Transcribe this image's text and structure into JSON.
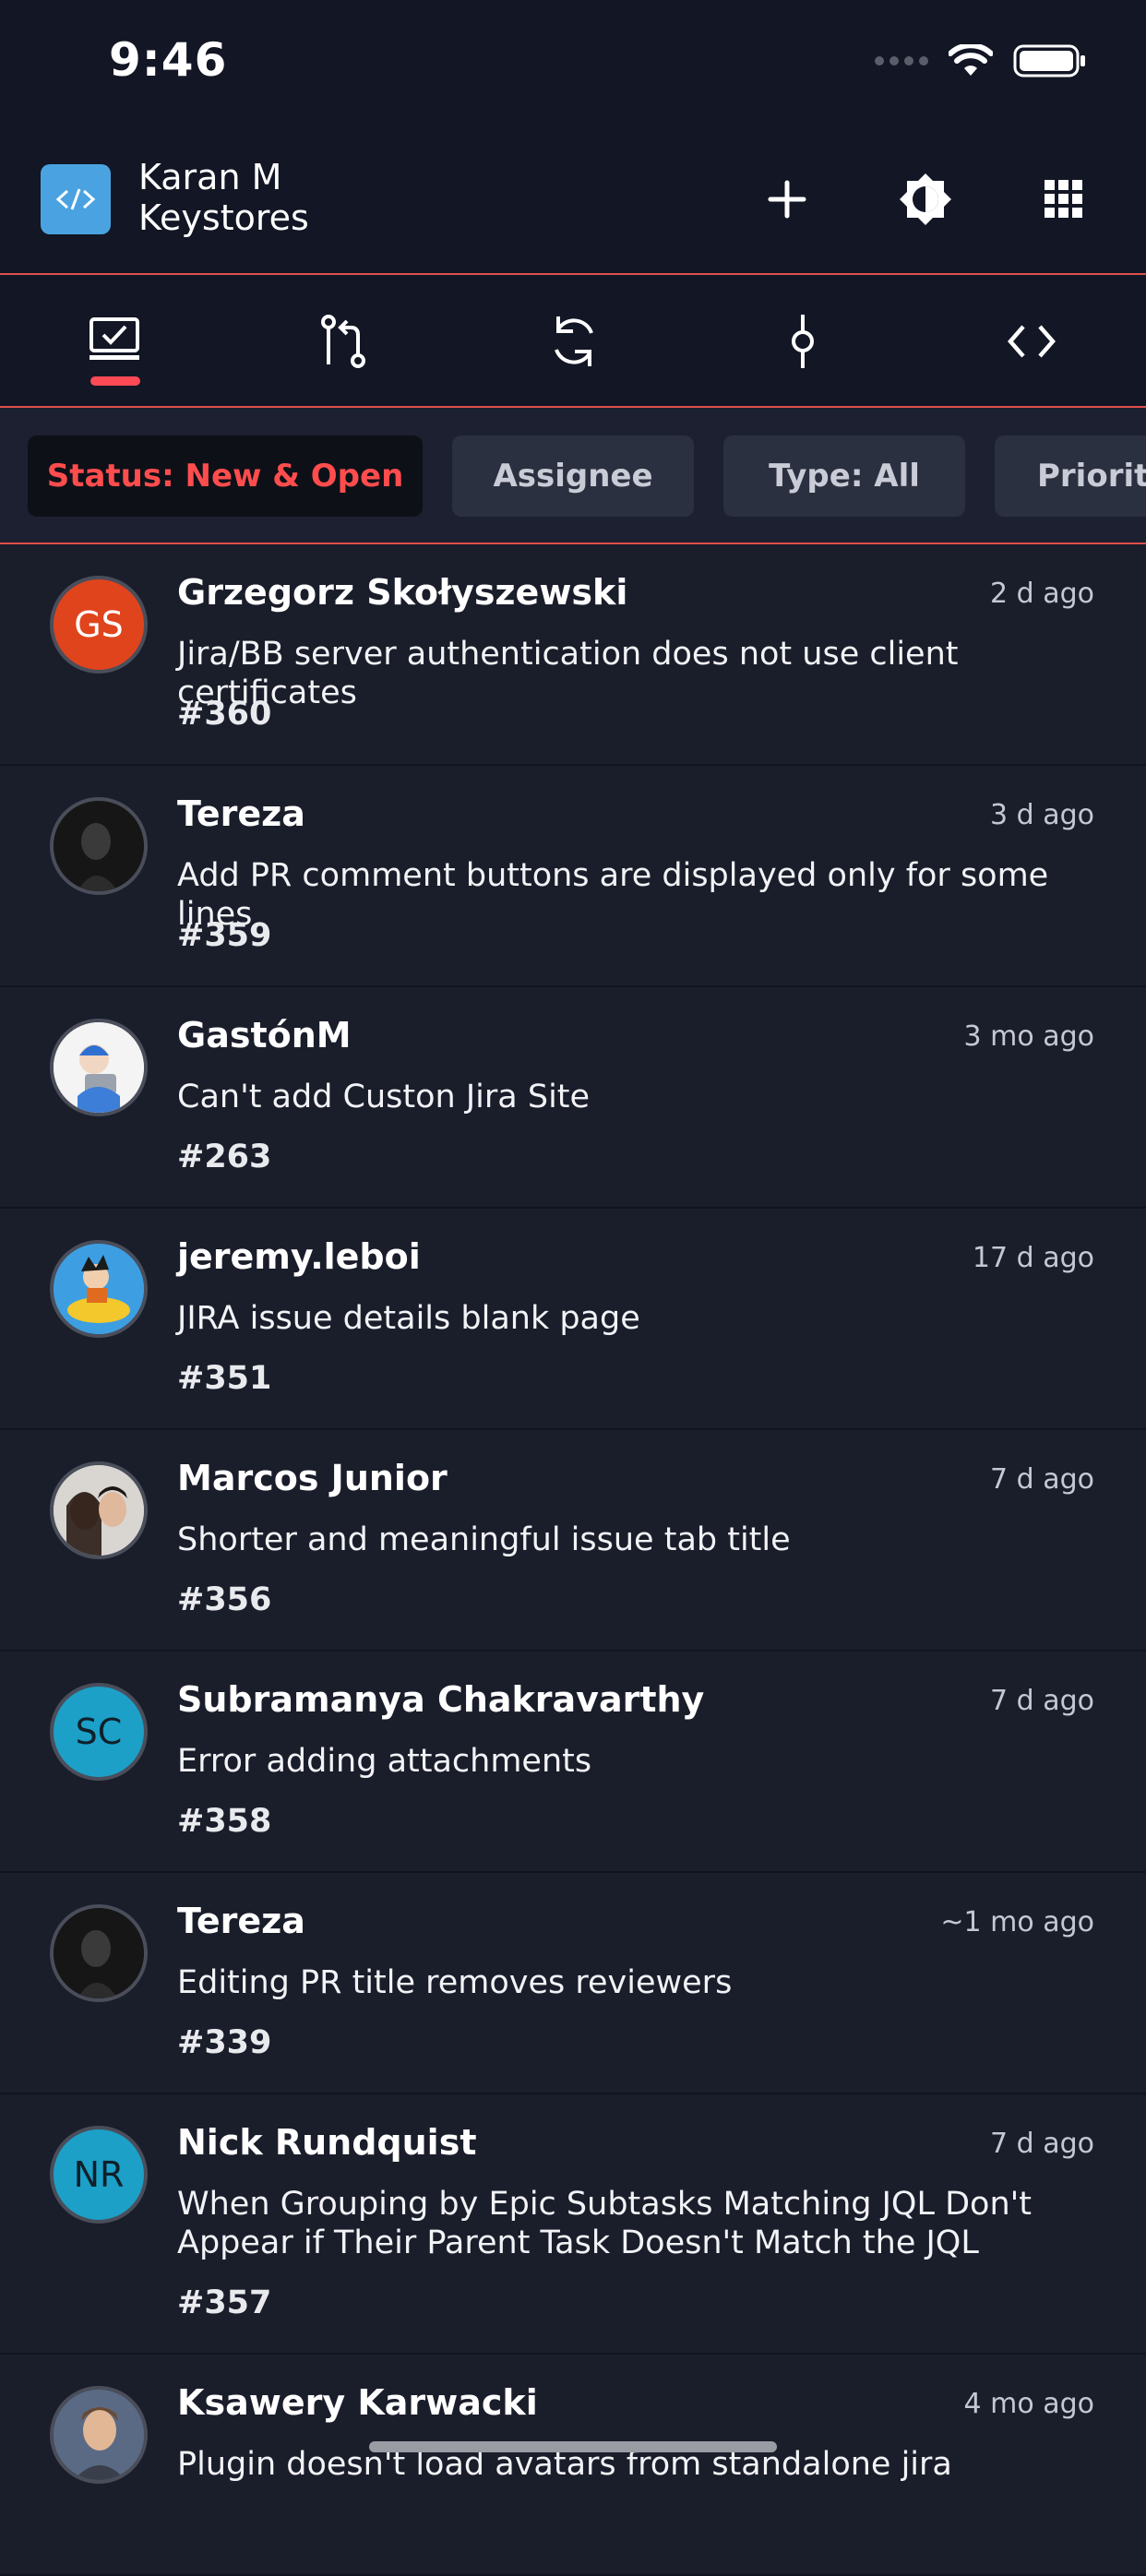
{
  "status_bar": {
    "time": "9:46"
  },
  "header": {
    "title": "Karan M",
    "subtitle": "Keystores"
  },
  "filters": [
    {
      "label": "Status: New & Open",
      "active": true
    },
    {
      "label": "Assignee",
      "active": false
    },
    {
      "label": "Type: All",
      "active": false
    },
    {
      "label": "Priority",
      "active": false
    }
  ],
  "issues": [
    {
      "author": "Grzegorz Skołyszewski",
      "initials": "GS",
      "time": "2 d ago",
      "title": "Jira/BB server authentication does not use client certificates",
      "number": "#360"
    },
    {
      "author": "Tereza",
      "initials": "",
      "time": "3 d ago",
      "title": "Add PR comment buttons are displayed only for some lines",
      "number": "#359"
    },
    {
      "author": "GastónM",
      "initials": "",
      "time": "3 mo ago",
      "title": "Can't add Custon Jira Site",
      "number": "#263"
    },
    {
      "author": "jeremy.leboi",
      "initials": "",
      "time": "17 d ago",
      "title": "JIRA issue details blank page",
      "number": "#351"
    },
    {
      "author": "Marcos Junior",
      "initials": "",
      "time": "7 d ago",
      "title": "Shorter and meaningful issue tab title",
      "number": "#356"
    },
    {
      "author": "Subramanya Chakravarthy",
      "initials": "SC",
      "time": "7 d ago",
      "title": "Error adding attachments",
      "number": "#358"
    },
    {
      "author": "Tereza",
      "initials": "",
      "time": "~1 mo ago",
      "title": "Editing PR title removes reviewers",
      "number": "#339"
    },
    {
      "author": "Nick Rundquist",
      "initials": "NR",
      "time": "7 d ago",
      "title": "When Grouping by Epic Subtasks Matching JQL Don't Appear if Their Parent Task Doesn't Match the JQL",
      "number": "#357"
    },
    {
      "author": "Ksawery Karwacki",
      "initials": "",
      "time": "4 mo ago",
      "title": "Plugin doesn't load avatars from standalone jira",
      "number": ""
    }
  ],
  "colors": {
    "accent": "#ff4a55",
    "avatar_orange": "#e0441c",
    "avatar_cyan": "#1ca0c8"
  }
}
